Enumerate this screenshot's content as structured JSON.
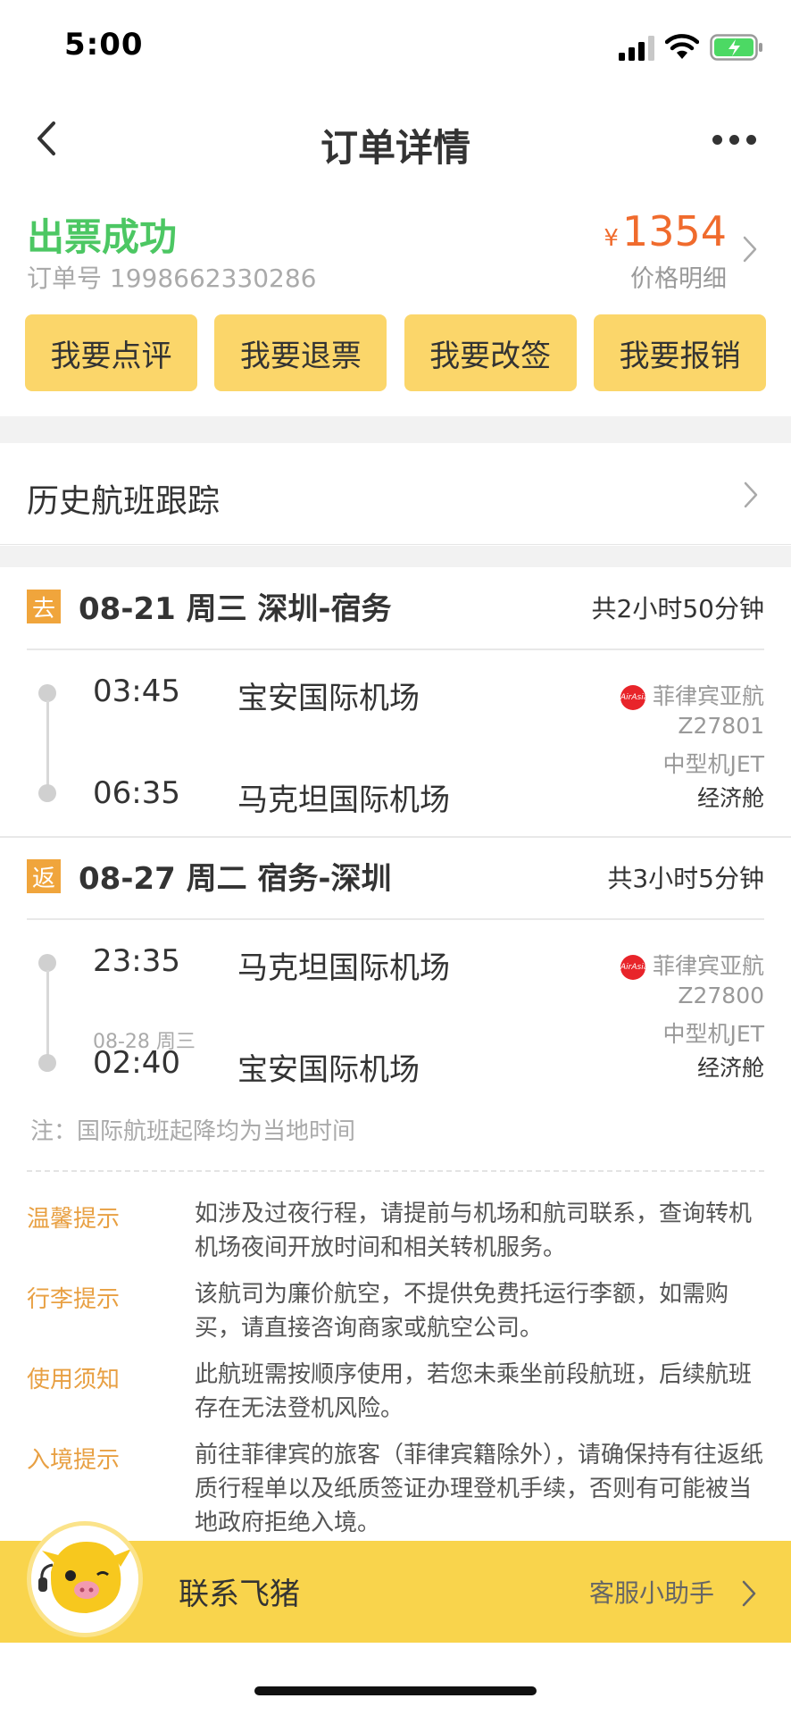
{
  "status_bar": {
    "time": "5:00"
  },
  "nav": {
    "title": "订单详情"
  },
  "order": {
    "status": "出票成功",
    "order_number": "订单号 1998662330286",
    "currency": "¥",
    "price": "1354",
    "price_detail": "价格明细"
  },
  "actions": [
    "我要点评",
    "我要退票",
    "我要改签",
    "我要报销"
  ],
  "history": {
    "label": "历史航班跟踪"
  },
  "outbound": {
    "tag": "去",
    "route": "08-21 周三 深圳-宿务",
    "duration": "共2小时50分钟",
    "dep_time": "03:45",
    "dep_airport": "宝安国际机场",
    "arr_time": "06:35",
    "arr_airport": "马克坦国际机场",
    "airline": "菲律宾亚航",
    "airline_logo_text": "AirAsia",
    "flight_no": "Z27801",
    "aircraft": "中型机JET",
    "cabin": "经济舱"
  },
  "return": {
    "tag": "返",
    "route": "08-27 周二 宿务-深圳",
    "duration": "共3小时5分钟",
    "dep_time": "23:35",
    "dep_airport": "马克坦国际机场",
    "arr_date_note": "08-28 周三",
    "arr_time": "02:40",
    "arr_airport": "宝安国际机场",
    "airline": "菲律宾亚航",
    "airline_logo_text": "AirAsia",
    "flight_no": "Z27800",
    "aircraft": "中型机JET",
    "cabin": "经济舱"
  },
  "note": "注：国际航班起降均为当地时间",
  "tips": [
    {
      "label": "温馨提示",
      "text": "如涉及过夜行程，请提前与机场和航司联系，查询转机机场夜间开放时间和相关转机服务。"
    },
    {
      "label": "行李提示",
      "text": "该航司为廉价航空，不提供免费托运行李额，如需购买，请直接咨询商家或航空公司。"
    },
    {
      "label": "使用须知",
      "text": "此航班需按顺序使用，若您未乘坐前段航班，后续航班存在无法登机风险。"
    },
    {
      "label": "入境提示",
      "text": "前往菲律宾的旅客（菲律宾籍除外），请确保持有往返纸质行程单以及纸质签证办理登机手续，否则有可能被当地政府拒绝入境。"
    }
  ],
  "contact": {
    "title": "联系飞猪",
    "helper": "客服小助手"
  },
  "colors": {
    "accent_yellow": "#fbd66a",
    "success_green": "#4cc763",
    "price_orange": "#f06b2d",
    "tip_orange": "#e8a043",
    "tag_orange": "#f0a53c"
  }
}
